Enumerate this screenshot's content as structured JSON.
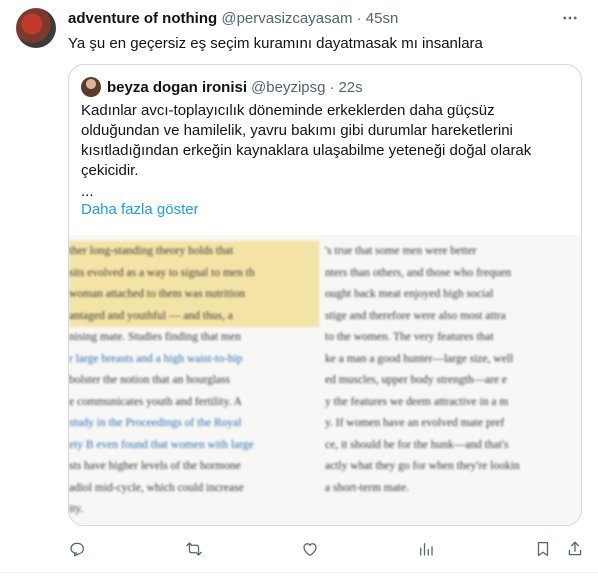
{
  "tweet": {
    "author_name": "adventure of nothing",
    "author_handle": "@pervasizcayasam",
    "separator": "·",
    "time": "45sn",
    "text": "Ya şu en geçersiz eş seçim kuramını dayatmasak mı insanlara"
  },
  "quote": {
    "author_name": "beyza dogan ironisi",
    "author_handle": "@beyzipsg",
    "separator": "·",
    "time": "22s",
    "text": "Kadınlar avcı-toplayıcılık döneminde erkeklerden daha güçsüz olduğundan ve hamilelik, yavru bakımı gibi durumlar hareketlerini kısıtladığından erkeğin kaynaklara ulaşabilme yeteneği doğal olarak çekicidir.",
    "ellipsis": "...",
    "show_more": "Daha fazla göster",
    "image_text": {
      "left": [
        "ther long-standing theory holds that",
        "sits evolved as a way to signal to men th",
        "woman attached to them was nutrition",
        "antaged and youthful — and thus, a",
        "nising mate. Studies finding that men",
        "r large breasts and a high waist-to-hip",
        "bolster the notion that an hourglass",
        "e communicates youth and fertility. A",
        "study in the Proceedings of the Royal",
        "ety B even found that women with large",
        "sts have higher levels of the hormone",
        "adiol mid-cycle, which could increase",
        "ity."
      ],
      "right": [
        "'s true that some men were better",
        "nters than others, and those who frequen",
        "ought back meat enjoyed high social",
        "stige and therefore were also most attra",
        "to the women. The very features that",
        "ke a man a good hunter—large size, well",
        "ed muscles, upper body strength—are e",
        "y the features we deem attractive in a m",
        "y. If women have an evolved mate pref",
        "ce, it should be for the hunk—and that's",
        "actly what they go for when they're lookin",
        "a short-term mate."
      ]
    }
  },
  "actions": {
    "icons": [
      "reply-icon",
      "retweet-icon",
      "like-icon",
      "views-icon",
      "bookmark-icon",
      "share-icon"
    ]
  },
  "colors": {
    "link": "#1d9bf0",
    "muted": "#536471",
    "border": "#cfd9de",
    "highlight": "#f4e3a6"
  }
}
